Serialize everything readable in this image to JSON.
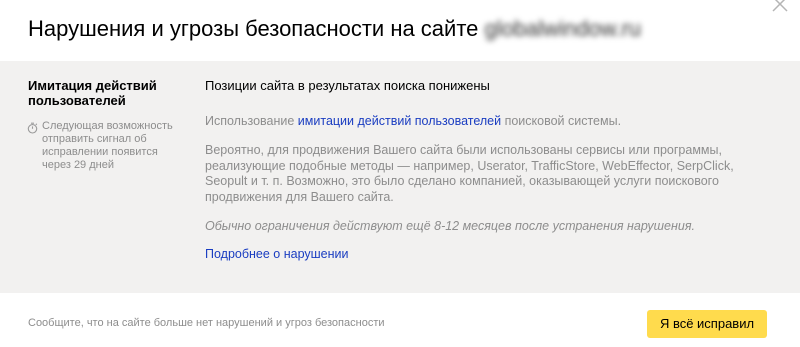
{
  "dialog": {
    "title_prefix": "Нарушения и угрозы безопасности на сайте ",
    "title_domain": "globalwindow.ru",
    "close_icon": "close-icon"
  },
  "sidebar": {
    "violation_name": "Имитация действий пользователей",
    "timer_icon": "stopwatch-icon",
    "timer_text": "Следующая возможность отправить сигнал об исправлении появится через 29 дней"
  },
  "content": {
    "issue_title": "Позиции сайта в результатах поиска понижены",
    "p1_before": "Использование ",
    "p1_link": "имитации действий пользователей",
    "p1_after": " поисковой системы.",
    "p2": "Вероятно, для продвижения Вашего сайта были использованы сервисы или программы, реализующие подобные методы — например, Userator, TrafficStore, WebEffector, SerpClick, Seopult и т. п. Возможно, это было сделано компанией, оказывающей услуги поискового продвижения для Вашего сайта.",
    "p3": "Обычно ограничения действуют ещё 8-12 месяцев после устранения нарушения.",
    "more_link": "Подробнее о нарушении"
  },
  "footer": {
    "hint": "Сообщите, что на сайте больше нет нарушений и угроз безопасности",
    "button_label": "Я всё исправил"
  },
  "colors": {
    "accent_button": "#ffdb4d",
    "link": "#1a3dc1",
    "panel_bg": "#f2f1f0",
    "muted_text": "#8d8d8d"
  }
}
